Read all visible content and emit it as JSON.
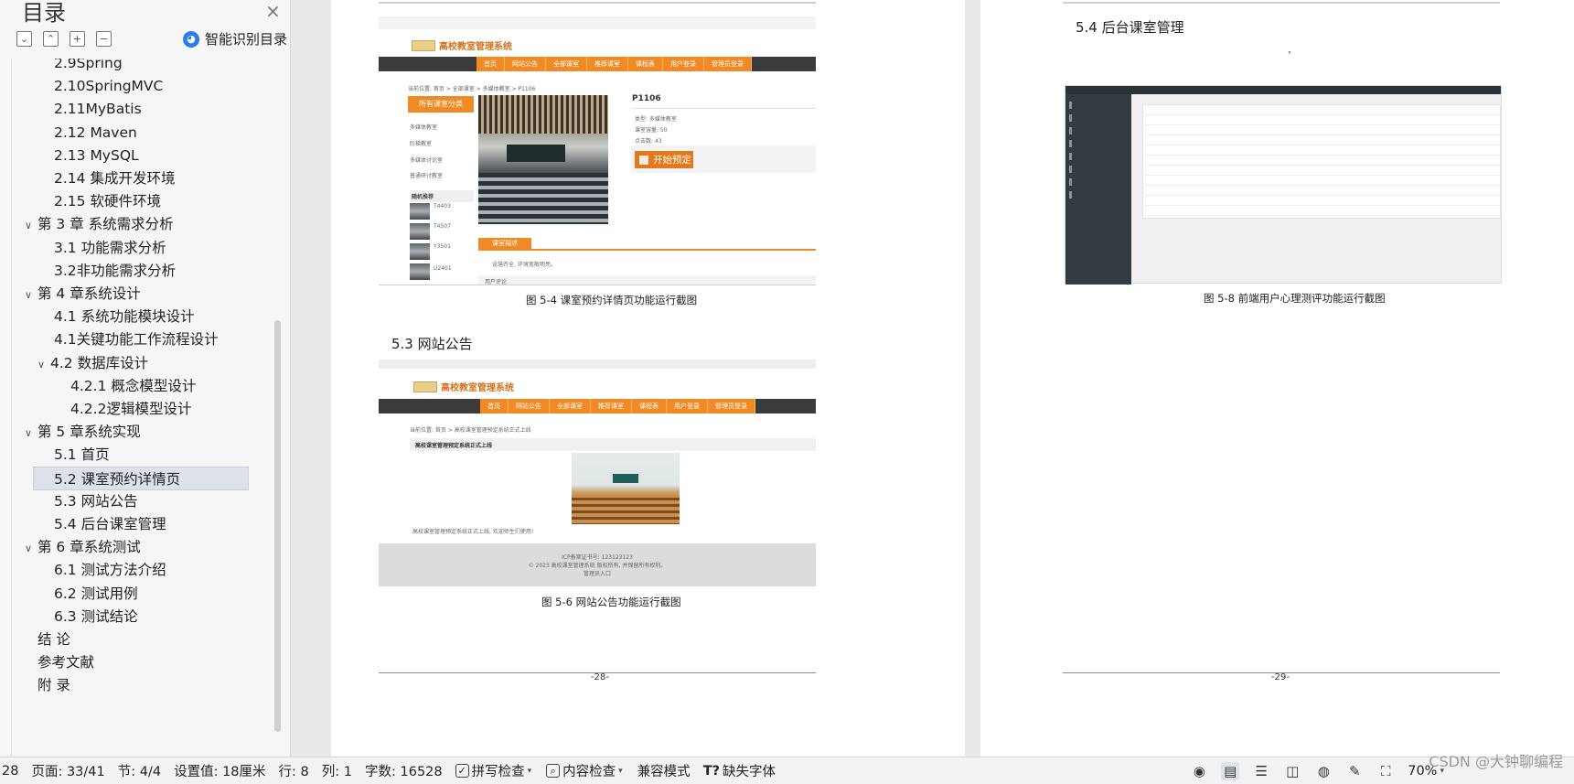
{
  "sidebar": {
    "title": "目录",
    "smart_label": "智能识别目录",
    "items": [
      {
        "label": "2.9Spring",
        "caret": ""
      },
      {
        "label": "2.10SpringMVC",
        "caret": ""
      },
      {
        "label": "2.11MyBatis",
        "caret": ""
      },
      {
        "label": "2.12  Maven",
        "caret": ""
      },
      {
        "label": "2.13  MySQL",
        "caret": ""
      },
      {
        "label": "2.14  集成开发环境",
        "caret": ""
      },
      {
        "label": "2.15  软硬件环境",
        "caret": ""
      },
      {
        "label": "第 3 章  系统需求分析",
        "caret": "∨"
      },
      {
        "label": "3.1  功能需求分析",
        "caret": ""
      },
      {
        "label": "3.2非功能需求分析",
        "caret": ""
      },
      {
        "label": "第 4 章系统设计",
        "caret": "∨"
      },
      {
        "label": "4.1  系统功能模块设计",
        "caret": ""
      },
      {
        "label": "4.1关键功能工作流程设计",
        "caret": ""
      },
      {
        "label": "4.2  数据库设计",
        "caret": "∨"
      },
      {
        "label": "4.2.1  概念模型设计",
        "caret": ""
      },
      {
        "label": "4.2.2逻辑模型设计",
        "caret": ""
      },
      {
        "label": "第 5 章系统实现",
        "caret": "∨"
      },
      {
        "label": "5.1  首页",
        "caret": ""
      },
      {
        "label": "5.2  课室预约详情页",
        "caret": ""
      },
      {
        "label": "5.3  网站公告",
        "caret": ""
      },
      {
        "label": "5.4  后台课室管理",
        "caret": ""
      },
      {
        "label": "第 6 章系统测试",
        "caret": "∨"
      },
      {
        "label": "6.1  测试方法介绍",
        "caret": ""
      },
      {
        "label": "6.2  测试用例",
        "caret": ""
      },
      {
        "label": "6.3  测试结论",
        "caret": ""
      },
      {
        "label": "结      论",
        "caret": ""
      },
      {
        "label": "参考文献",
        "caret": ""
      },
      {
        "label": "附      录",
        "caret": ""
      }
    ]
  },
  "doc": {
    "site_title": "高校教室管理系统",
    "nav": [
      "首页",
      "网站公告",
      "全部课室",
      "推荐课室",
      "课程表",
      "用户登录",
      "管理员登录"
    ],
    "fig1": {
      "breadcrumb": "当前位置: 首页 > 全部课室 > 多媒体教室 > P1106",
      "category_title": "所有课室分类",
      "categories": [
        "多媒体教室",
        "阶梯教室",
        "多媒体讨论室",
        "普通研讨教室"
      ],
      "random_title": "随机推荐",
      "thumbs": [
        "T4403",
        "T4507",
        "Y3501",
        "U2401"
      ],
      "room_name": "P1106",
      "type_label": "类型: 多媒体教室",
      "capacity_label": "课室容量: 50",
      "clicks_label": "点击数: 43",
      "book_btn": "开始预定",
      "desc_tab": "课室描述",
      "desc_text": "设施齐全, 环境宽敞明亮。",
      "comments_label": "用户评论",
      "caption": "图 5-4  课室预约详情页功能运行截图"
    },
    "section_53": "5.3    网站公告",
    "fig2": {
      "breadcrumb": "当前位置: 首页 > 高校课室管理预定系统正式上线",
      "notice_title": "高校课室管理预定系统正式上线",
      "notice_text": "高校课室管理预定系统正式上线, 欢迎师生们使用!",
      "footer_line1": "ICP备案证书号: 123123123",
      "footer_line2": "© 2023 高校课室管理系统 版权所有, 并保留所有权利。",
      "footer_line3": "管理员入口",
      "caption": "图 5-6  网站公告功能运行截图"
    },
    "page_left_num": "-28-",
    "section_54": "5.4    后台课室管理",
    "fig3": {
      "caption": "图 5-8  前端用户心理测评功能运行截图"
    },
    "page_right_num": "-29-"
  },
  "status": {
    "page_num": "28",
    "page": "页面: 33/41",
    "section": "节: 4/4",
    "setting": "设置值: 18厘米",
    "row": "行: 8",
    "col": "列: 1",
    "words": "字数: 16528",
    "spell": "拼写检查",
    "content": "内容检查",
    "compat": "兼容模式",
    "missing_font": "缺失字体",
    "zoom": "70%"
  },
  "watermark": "CSDN @大钟聊编程"
}
